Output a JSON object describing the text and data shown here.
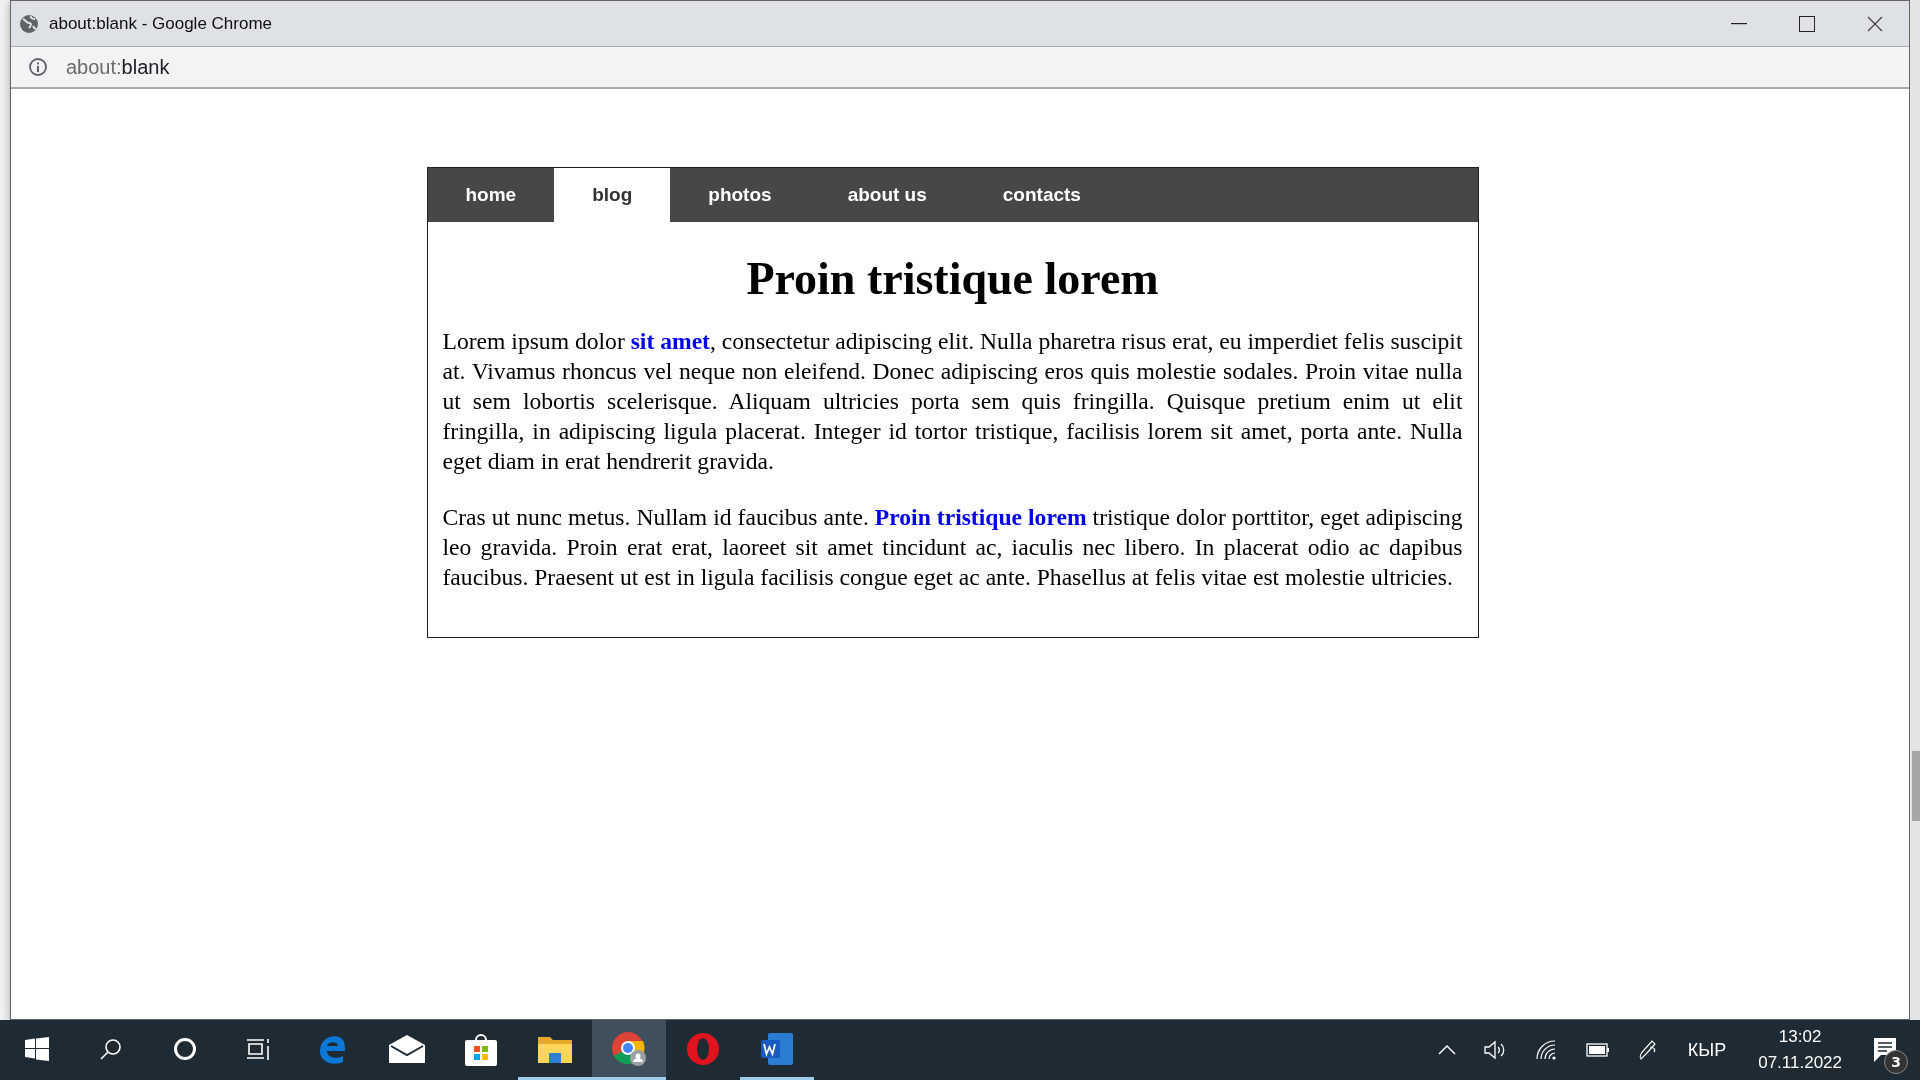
{
  "window": {
    "title": "about:blank - Google Chrome"
  },
  "address_bar": {
    "scheme": "about:",
    "rest": "blank"
  },
  "nav": {
    "tabs": [
      {
        "label": "home",
        "selected": false
      },
      {
        "label": "blog",
        "selected": true
      },
      {
        "label": "photos",
        "selected": false
      },
      {
        "label": "about us",
        "selected": false
      },
      {
        "label": "contacts",
        "selected": false
      }
    ]
  },
  "article": {
    "heading": "Proin tristique lorem",
    "paragraphs": [
      [
        {
          "kind": "text",
          "text": "Lorem ipsum dolor "
        },
        {
          "kind": "link",
          "text": "sit amet"
        },
        {
          "kind": "text",
          "text": ", consectetur adipiscing elit. Nulla pharetra risus erat, eu imperdiet felis suscipit at. Vivamus rhoncus vel neque non eleifend. Donec adipiscing eros quis molestie sodales. Proin vitae nulla ut sem lobortis scelerisque. Aliquam ultricies porta sem quis fringilla. Quisque pretium enim ut elit fringilla, in adipiscing ligula placerat. Integer id tortor tristique, facilisis lorem sit amet, porta ante. Nulla eget diam in erat hendrerit gravida."
        }
      ],
      [
        {
          "kind": "text",
          "text": "Cras ut nunc metus. Nullam id faucibus ante. "
        },
        {
          "kind": "link",
          "text": "Proin tristique lorem"
        },
        {
          "kind": "text",
          "text": " tristique dolor porttitor, eget adipiscing leo gravida. Proin erat erat, laoreet sit amet tincidunt ac, iaculis nec libero. In placerat odio ac dapibus faucibus. Praesent ut est in ligula facilisis congue eget ac ante. Phasellus at felis vitae est molestie ultricies."
        }
      ]
    ]
  },
  "taskbar": {
    "apps": [
      {
        "kind": "start",
        "running": false,
        "active": false
      },
      {
        "kind": "search",
        "running": false,
        "active": false
      },
      {
        "kind": "cortana",
        "running": false,
        "active": false
      },
      {
        "kind": "taskview",
        "running": false,
        "active": false
      },
      {
        "kind": "edge",
        "running": false,
        "active": false
      },
      {
        "kind": "mail",
        "running": false,
        "active": false
      },
      {
        "kind": "store",
        "running": false,
        "active": false
      },
      {
        "kind": "explorer",
        "running": true,
        "active": false
      },
      {
        "kind": "chrome",
        "running": true,
        "active": true
      },
      {
        "kind": "opera",
        "running": false,
        "active": false
      },
      {
        "kind": "word",
        "running": true,
        "active": false
      }
    ],
    "language": "КЫР",
    "time": "13:02",
    "date": "07.11.2022",
    "notification_count": "3"
  }
}
